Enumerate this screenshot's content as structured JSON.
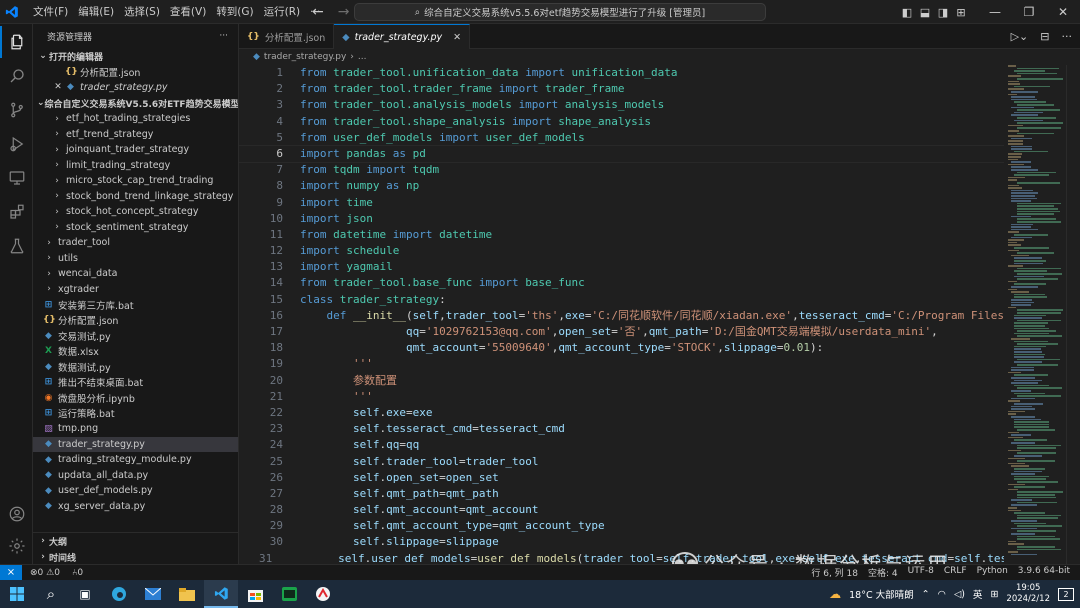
{
  "titlebar": {
    "menu": [
      "文件(F)",
      "编辑(E)",
      "选择(S)",
      "查看(V)",
      "转到(G)",
      "运行(R)",
      "···"
    ],
    "search_text": "综合自定义交易系统v5.5.6对etf趋势交易模型进行了升级 [管理员]"
  },
  "sidebar": {
    "header": "资源管理器",
    "open_editors_title": "打开的编辑器",
    "open_editors": [
      {
        "name": "分析配置.json",
        "icon": "json-icon",
        "color": "#e8c06a",
        "italic": false,
        "close": false
      },
      {
        "name": "trader_strategy.py",
        "icon": "python-icon",
        "color": "#4b8bbe",
        "italic": true,
        "close": true
      }
    ],
    "workspace_title": "综合自定义交易系统V5.5.6对ETF趋势交易模型进行了...",
    "tree": [
      {
        "name": "etf_hot_trading_strategies",
        "type": "folder",
        "indent": 2
      },
      {
        "name": "etf_trend_strategy",
        "type": "folder",
        "indent": 2
      },
      {
        "name": "joinquant_trader_strategy",
        "type": "folder",
        "indent": 2
      },
      {
        "name": "limit_trading_strategy",
        "type": "folder",
        "indent": 2
      },
      {
        "name": "micro_stock_cap_trend_trading",
        "type": "folder",
        "indent": 2
      },
      {
        "name": "stock_bond_trend_linkage_strategy",
        "type": "folder",
        "indent": 2
      },
      {
        "name": "stock_hot_concept_strategy",
        "type": "folder",
        "indent": 2
      },
      {
        "name": "stock_sentiment_strategy",
        "type": "folder",
        "indent": 2
      },
      {
        "name": "trader_tool",
        "type": "folder",
        "indent": 1
      },
      {
        "name": "utils",
        "type": "folder",
        "indent": 1
      },
      {
        "name": "wencai_data",
        "type": "folder",
        "indent": 1
      },
      {
        "name": "xgtrader",
        "type": "folder",
        "indent": 1
      },
      {
        "name": "安装第三方库.bat",
        "type": "bat",
        "indent": 1
      },
      {
        "name": "分析配置.json",
        "type": "json",
        "indent": 1
      },
      {
        "name": "交易测试.py",
        "type": "py",
        "indent": 1
      },
      {
        "name": "数据.xlsx",
        "type": "xlsx",
        "indent": 1
      },
      {
        "name": "数据测试.py",
        "type": "py",
        "indent": 1
      },
      {
        "name": "推出不结束桌面.bat",
        "type": "bat",
        "indent": 1
      },
      {
        "name": "微盘股分析.ipynb",
        "type": "ipynb",
        "indent": 1
      },
      {
        "name": "运行策略.bat",
        "type": "bat",
        "indent": 1
      },
      {
        "name": "tmp.png",
        "type": "png",
        "indent": 1
      },
      {
        "name": "trader_strategy.py",
        "type": "py",
        "indent": 1,
        "selected": true
      },
      {
        "name": "trading_strategy_module.py",
        "type": "py",
        "indent": 1
      },
      {
        "name": "updata_all_data.py",
        "type": "py",
        "indent": 1
      },
      {
        "name": "user_def_models.py",
        "type": "py",
        "indent": 1
      },
      {
        "name": "xg_server_data.py",
        "type": "py",
        "indent": 1
      }
    ],
    "outline_title": "大纲",
    "timeline_title": "时间线"
  },
  "tabs": [
    {
      "label": "分析配置.json",
      "active": false,
      "icon": "json-icon"
    },
    {
      "label": "trader_strategy.py",
      "active": true,
      "icon": "python-icon"
    }
  ],
  "breadcrumb": {
    "file": "trader_strategy.py",
    "rest": "..."
  },
  "code_lines": [
    [
      [
        "kw",
        "from "
      ],
      [
        "mod",
        "trader_tool.unification_data "
      ],
      [
        "kw",
        "import "
      ],
      [
        "mod",
        "unification_data"
      ]
    ],
    [
      [
        "kw",
        "from "
      ],
      [
        "mod",
        "trader_tool.trader_frame "
      ],
      [
        "kw",
        "import "
      ],
      [
        "mod",
        "trader_frame"
      ]
    ],
    [
      [
        "kw",
        "from "
      ],
      [
        "mod",
        "trader_tool.analysis_models "
      ],
      [
        "kw",
        "import "
      ],
      [
        "mod",
        "analysis_models"
      ]
    ],
    [
      [
        "kw",
        "from "
      ],
      [
        "mod",
        "trader_tool.shape_analysis "
      ],
      [
        "kw",
        "import "
      ],
      [
        "mod",
        "shape_analysis"
      ]
    ],
    [
      [
        "kw",
        "from "
      ],
      [
        "mod",
        "user_def_models "
      ],
      [
        "kw",
        "import "
      ],
      [
        "mod",
        "user_def_models"
      ]
    ],
    [
      [
        "kw",
        "import "
      ],
      [
        "mod",
        "pandas "
      ],
      [
        "kw",
        "as "
      ],
      [
        "mod",
        "pd"
      ]
    ],
    [
      [
        "kw",
        "from "
      ],
      [
        "mod",
        "tqdm "
      ],
      [
        "kw",
        "import "
      ],
      [
        "mod",
        "tqdm"
      ]
    ],
    [
      [
        "kw",
        "import "
      ],
      [
        "mod",
        "numpy "
      ],
      [
        "kw",
        "as "
      ],
      [
        "mod",
        "np"
      ]
    ],
    [
      [
        "kw",
        "import "
      ],
      [
        "mod",
        "time"
      ]
    ],
    [
      [
        "kw",
        "import "
      ],
      [
        "mod",
        "json"
      ]
    ],
    [
      [
        "kw",
        "from "
      ],
      [
        "mod",
        "datetime "
      ],
      [
        "kw",
        "import "
      ],
      [
        "mod",
        "datetime"
      ]
    ],
    [
      [
        "kw",
        "import "
      ],
      [
        "mod",
        "schedule"
      ]
    ],
    [
      [
        "kw",
        "import "
      ],
      [
        "mod",
        "yagmail"
      ]
    ],
    [
      [
        "kw",
        "from "
      ],
      [
        "mod",
        "trader_tool.base_func "
      ],
      [
        "kw",
        "import "
      ],
      [
        "mod",
        "base_func"
      ]
    ],
    [
      [
        "self",
        "class "
      ],
      [
        "cls",
        "trader_strategy"
      ],
      [
        "plain",
        ":"
      ]
    ],
    [
      [
        "plain",
        "    "
      ],
      [
        "self",
        "def "
      ],
      [
        "fn",
        "__init__"
      ],
      [
        "plain",
        "("
      ],
      [
        "var",
        "self"
      ],
      [
        "plain",
        ","
      ],
      [
        "var",
        "trader_tool"
      ],
      [
        "plain",
        "="
      ],
      [
        "str",
        "'ths'"
      ],
      [
        "plain",
        ","
      ],
      [
        "var",
        "exe"
      ],
      [
        "plain",
        "="
      ],
      [
        "str",
        "'C:/同花顺软件/同花顺/xiadan.exe'"
      ],
      [
        "plain",
        ","
      ],
      [
        "var",
        "tesseract_cmd"
      ],
      [
        "plain",
        "="
      ],
      [
        "str",
        "'C:/Program Files"
      ]
    ],
    [
      [
        "plain",
        "                "
      ],
      [
        "var",
        "qq"
      ],
      [
        "plain",
        "="
      ],
      [
        "str",
        "'1029762153@qq.com'"
      ],
      [
        "plain",
        ","
      ],
      [
        "var",
        "open_set"
      ],
      [
        "plain",
        "="
      ],
      [
        "str",
        "'否'"
      ],
      [
        "plain",
        ","
      ],
      [
        "var",
        "qmt_path"
      ],
      [
        "plain",
        "="
      ],
      [
        "str",
        "'D:/国金QMT交易端模拟/userdata_mini'"
      ],
      [
        "plain",
        ","
      ]
    ],
    [
      [
        "plain",
        "                "
      ],
      [
        "var",
        "qmt_account"
      ],
      [
        "plain",
        "="
      ],
      [
        "str",
        "'55009640'"
      ],
      [
        "plain",
        ","
      ],
      [
        "var",
        "qmt_account_type"
      ],
      [
        "plain",
        "="
      ],
      [
        "str",
        "'STOCK'"
      ],
      [
        "plain",
        ","
      ],
      [
        "var",
        "slippage"
      ],
      [
        "plain",
        "="
      ],
      [
        "num",
        "0.01"
      ],
      [
        "plain",
        "):"
      ]
    ],
    [
      [
        "plain",
        "        "
      ],
      [
        "str",
        "'''"
      ]
    ],
    [
      [
        "plain",
        "        "
      ],
      [
        "str",
        "参数配置"
      ]
    ],
    [
      [
        "plain",
        "        "
      ],
      [
        "str",
        "'''"
      ]
    ],
    [
      [
        "plain",
        "        "
      ],
      [
        "var",
        "self"
      ],
      [
        "plain",
        "."
      ],
      [
        "var",
        "exe"
      ],
      [
        "plain",
        "="
      ],
      [
        "var",
        "exe"
      ]
    ],
    [
      [
        "plain",
        "        "
      ],
      [
        "var",
        "self"
      ],
      [
        "plain",
        "."
      ],
      [
        "var",
        "tesseract_cmd"
      ],
      [
        "plain",
        "="
      ],
      [
        "var",
        "tesseract_cmd"
      ]
    ],
    [
      [
        "plain",
        "        "
      ],
      [
        "var",
        "self"
      ],
      [
        "plain",
        "."
      ],
      [
        "var",
        "qq"
      ],
      [
        "plain",
        "="
      ],
      [
        "var",
        "qq"
      ]
    ],
    [
      [
        "plain",
        "        "
      ],
      [
        "var",
        "self"
      ],
      [
        "plain",
        "."
      ],
      [
        "var",
        "trader_tool"
      ],
      [
        "plain",
        "="
      ],
      [
        "var",
        "trader_tool"
      ]
    ],
    [
      [
        "plain",
        "        "
      ],
      [
        "var",
        "self"
      ],
      [
        "plain",
        "."
      ],
      [
        "var",
        "open_set"
      ],
      [
        "plain",
        "="
      ],
      [
        "var",
        "open_set"
      ]
    ],
    [
      [
        "plain",
        "        "
      ],
      [
        "var",
        "self"
      ],
      [
        "plain",
        "."
      ],
      [
        "var",
        "qmt_path"
      ],
      [
        "plain",
        "="
      ],
      [
        "var",
        "qmt_path"
      ]
    ],
    [
      [
        "plain",
        "        "
      ],
      [
        "var",
        "self"
      ],
      [
        "plain",
        "."
      ],
      [
        "var",
        "qmt_account"
      ],
      [
        "plain",
        "="
      ],
      [
        "var",
        "qmt_account"
      ]
    ],
    [
      [
        "plain",
        "        "
      ],
      [
        "var",
        "self"
      ],
      [
        "plain",
        "."
      ],
      [
        "var",
        "qmt_account_type"
      ],
      [
        "plain",
        "="
      ],
      [
        "var",
        "qmt_account_type"
      ]
    ],
    [
      [
        "plain",
        "        "
      ],
      [
        "var",
        "self"
      ],
      [
        "plain",
        "."
      ],
      [
        "var",
        "slippage"
      ],
      [
        "plain",
        "="
      ],
      [
        "var",
        "slippage"
      ]
    ],
    [
      [
        "plain",
        "        "
      ],
      [
        "var",
        "self"
      ],
      [
        "plain",
        "."
      ],
      [
        "var",
        "user_def_models"
      ],
      [
        "plain",
        "="
      ],
      [
        "fn",
        "user_def_models"
      ],
      [
        "plain",
        "("
      ],
      [
        "var",
        "trader_tool"
      ],
      [
        "plain",
        "="
      ],
      [
        "var",
        "self"
      ],
      [
        "plain",
        "."
      ],
      [
        "var",
        "trader_tool"
      ],
      [
        "plain",
        ","
      ],
      [
        "var",
        "exe"
      ],
      [
        "plain",
        "="
      ],
      [
        "var",
        "self"
      ],
      [
        "plain",
        "."
      ],
      [
        "var",
        "exe"
      ],
      [
        "plain",
        ","
      ],
      [
        "var",
        "tesseract_cmd"
      ],
      [
        "plain",
        "="
      ],
      [
        "var",
        "self"
      ],
      [
        "plain",
        "."
      ],
      [
        "var",
        "tesseract_cmd"
      ],
      [
        "plain",
        ","
      ]
    ]
  ],
  "current_line": 6,
  "statusbar": {
    "errors": "⊗0",
    "warnings": "⚠0",
    "ports": "⑃0",
    "position": "行 6, 列 18",
    "spaces": "空格: 4",
    "encoding": "UTF-8",
    "eol": "CRLF",
    "language": "Python",
    "interpreter": "3.9.6 64-bit"
  },
  "watermark": "公众号 · 数据分析与运用",
  "taskbar": {
    "weather": "18°C 大部晴朗",
    "ime": "英",
    "time": "19:05",
    "date": "2024/2/12",
    "notif": "2"
  },
  "colors": {
    "accent": "#0078d4",
    "statusbar_remote": "#0078d4",
    "taskbar": "#1c2a3a"
  }
}
